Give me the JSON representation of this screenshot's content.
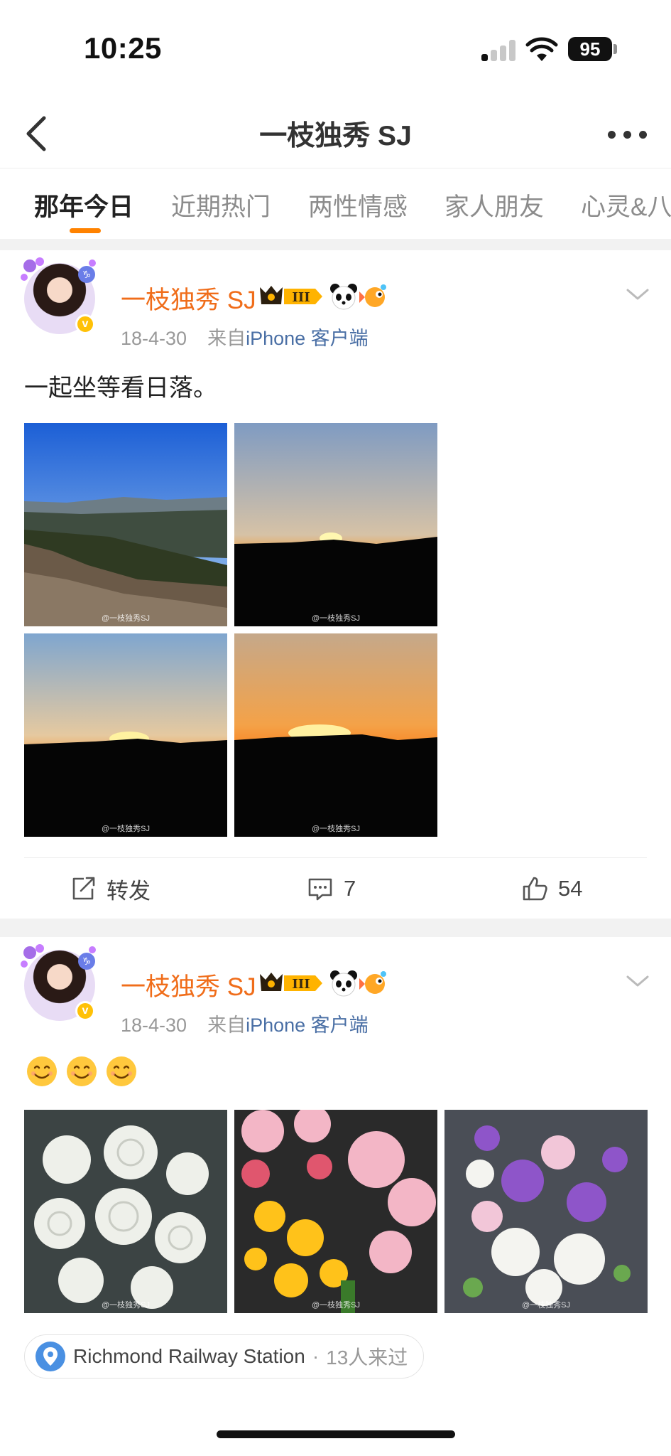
{
  "status_bar": {
    "time": "10:25",
    "battery": "95"
  },
  "nav": {
    "title": "一枝独秀 SJ"
  },
  "tabs": [
    {
      "label": "那年今日"
    },
    {
      "label": "近期热门"
    },
    {
      "label": "两性情感"
    },
    {
      "label": "家人朋友"
    },
    {
      "label": "心灵&八"
    }
  ],
  "posts": [
    {
      "username": "一枝独秀 SJ",
      "level": "III",
      "date": "18-4-30",
      "source_prefix": "来自",
      "source": "iPhone 客户端",
      "text": "一起坐等看日落。",
      "watermark": "@一枝独秀SJ",
      "actions": {
        "repost": "转发",
        "comments": "7",
        "likes": "54"
      }
    },
    {
      "username": "一枝独秀 SJ",
      "level": "III",
      "date": "18-4-30",
      "source_prefix": "来自",
      "source": "iPhone 客户端",
      "emoji": [
        "😊",
        "😊",
        "😊"
      ],
      "watermark": "@一枝独秀SJ",
      "location": {
        "name": "Richmond Railway Station",
        "sep": "·",
        "visitors": "13人来过"
      }
    }
  ],
  "colors": {
    "accent": "#ff8200",
    "username": "#f06d1a",
    "link": "#4a6fa5"
  }
}
